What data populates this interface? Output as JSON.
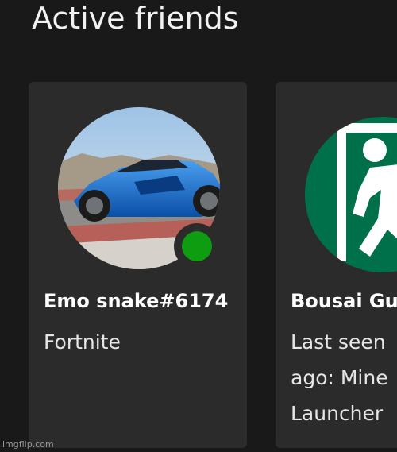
{
  "section": {
    "title": "Active friends"
  },
  "friends": [
    {
      "gamertag": "Emo snake#6174",
      "status": "Fortnite",
      "presence": "online",
      "avatar_icon": "blue-sports-car-photo"
    },
    {
      "gamertag": "Bousai Gu",
      "status_lines": [
        "Last seen",
        "ago: Mine",
        "Launcher"
      ],
      "avatar_icon": "emergency-exit-running-man-icon"
    }
  ],
  "colors": {
    "background": "#191919",
    "card": "#2b2b2b",
    "online": "#0e9d10",
    "exit_green": "#00704a"
  },
  "watermark": "imgflip.com"
}
